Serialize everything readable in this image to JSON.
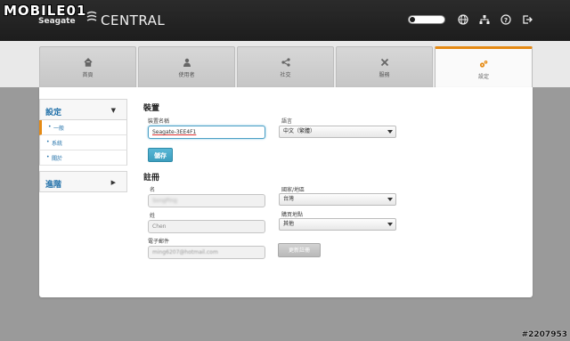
{
  "watermark": {
    "site": "MOBILE01"
  },
  "brand": {
    "seagate": "Seagate",
    "product": "CENTRAL"
  },
  "tabs": [
    {
      "label": "首頁",
      "icon": "home-icon"
    },
    {
      "label": "使用者",
      "icon": "user-icon"
    },
    {
      "label": "社交",
      "icon": "share-icon"
    },
    {
      "label": "服務",
      "icon": "tools-icon"
    },
    {
      "label": "設定",
      "icon": "gears-icon",
      "active": true
    }
  ],
  "sidebar": {
    "settings": {
      "label": "設定",
      "arrow": "▼"
    },
    "items": [
      {
        "label": "一般",
        "selected": true
      },
      {
        "label": "系統"
      },
      {
        "label": "關於"
      }
    ],
    "advanced": {
      "label": "進階",
      "arrow": "▶"
    }
  },
  "device": {
    "heading": "裝置",
    "name_label": "裝置名稱",
    "name_value": "Seagate-3EE4F1",
    "language_label": "語言",
    "language_value": "中文（繁體）",
    "save_label": "儲存"
  },
  "registration": {
    "heading": "註冊",
    "first_name_label": "名",
    "first_name_value": "SongPing",
    "country_label": "國家/地區",
    "country_value": "台灣",
    "last_name_label": "姓",
    "last_name_value": "Chen",
    "purchase_label": "購買地點",
    "purchase_value": "其他",
    "email_label": "電子郵件",
    "email_value": "ming6207@hotmail.com",
    "update_label": "更新註冊"
  },
  "credit": "#2207953",
  "colors": {
    "accent": "#e58a14",
    "link": "#1f6fa8",
    "button": "#3c9dbe"
  }
}
